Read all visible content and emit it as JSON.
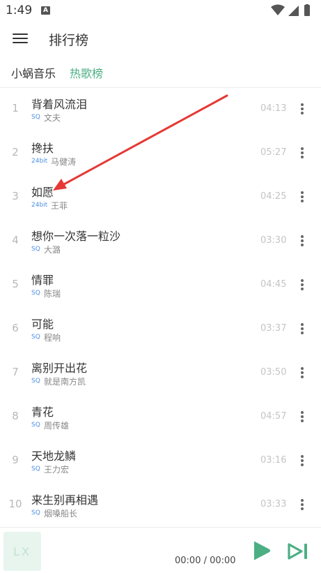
{
  "status_bar": {
    "time": "1:49",
    "notification_glyph": "A",
    "icons": [
      "wifi-icon",
      "signal-icon",
      "battery-icon"
    ]
  },
  "header": {
    "title": "排行榜",
    "menu_icon": "hamburger-menu-icon"
  },
  "tabs": {
    "source": "小蜗音乐",
    "active": "热歌榜"
  },
  "songs": [
    {
      "index": "1",
      "title": "背着风流泪",
      "quality": "SQ",
      "singer": "文夫",
      "duration": "04:13"
    },
    {
      "index": "2",
      "title": "搀扶",
      "quality": "24bit",
      "singer": "马健涛",
      "duration": "05:27"
    },
    {
      "index": "3",
      "title": "如愿",
      "quality": "24bit",
      "singer": "王菲",
      "duration": "04:25"
    },
    {
      "index": "4",
      "title": "想你一次落一粒沙",
      "quality": "SQ",
      "singer": "大潞",
      "duration": "03:30"
    },
    {
      "index": "5",
      "title": "情罪",
      "quality": "SQ",
      "singer": "陈瑞",
      "duration": "04:45"
    },
    {
      "index": "6",
      "title": "可能",
      "quality": "SQ",
      "singer": "程响",
      "duration": "03:37"
    },
    {
      "index": "7",
      "title": "离别开出花",
      "quality": "SQ",
      "singer": "就是南方凯",
      "duration": "03:50"
    },
    {
      "index": "8",
      "title": "青花",
      "quality": "SQ",
      "singer": "周传雄",
      "duration": "04:57"
    },
    {
      "index": "9",
      "title": "天地龙鳞",
      "quality": "SQ",
      "singer": "王力宏",
      "duration": "03:16"
    },
    {
      "index": "10",
      "title": "来生别再相遇",
      "quality": "SQ",
      "singer": "烟嗓船长",
      "duration": "03:33"
    }
  ],
  "player": {
    "logo": "LX",
    "time": "00:00 / 00:00",
    "play_icon": "play-icon",
    "next_icon": "skip-next-icon"
  },
  "colors": {
    "accent": "#4caf84",
    "quality": "#4a90e2",
    "annotation_arrow": "#e53935"
  },
  "annotation": {
    "type": "red-arrow",
    "points_to": "如愿"
  }
}
